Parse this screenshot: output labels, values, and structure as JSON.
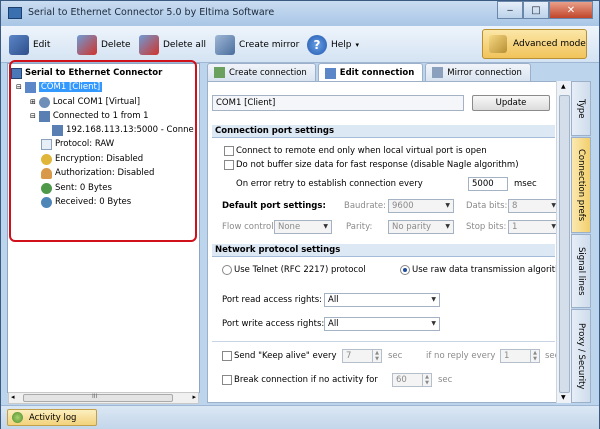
{
  "title": "Serial to Ethernet Connector 5.0 by Eltima Software",
  "toolbar": {
    "edit": "Edit",
    "delete": "Delete",
    "delete_all": "Delete all",
    "create_mirror": "Create mirror",
    "help": "Help",
    "advanced_mode": "Advanced mode"
  },
  "tree": {
    "root": "Serial to Ethernet Connector",
    "com1": "COM1 [Client]",
    "local": "Local COM1 [Virtual]",
    "connected": "Connected to 1 from 1",
    "remote": "192.168.113.13:5000 - Conne",
    "protocol": "Protocol: RAW",
    "encryption": "Encryption: Disabled",
    "authorization": "Authorization: Disabled",
    "sent": "Sent: 0 Bytes",
    "received": "Received: 0 Bytes"
  },
  "scroll_glyph": "III",
  "status": {
    "activity_log": "Activity log"
  },
  "tabs": [
    "Create connection",
    "Edit connection",
    "Mirror connection"
  ],
  "vtabs": [
    "Type",
    "Connection prefs",
    "Signal lines",
    "Proxy / Security"
  ],
  "panel": {
    "name_value": "COM1 [Client]",
    "update": "Update",
    "conn_section": "Connection port settings",
    "cb1": "Connect to remote end only when local virtual port is open",
    "cb2": "Do not buffer size data for fast response (disable Nagle algorithm)",
    "retry_label": "On error retry to establish connection every",
    "retry_value": "5000",
    "retry_unit": "msec",
    "default_port": "Default port settings:",
    "baudrate_label": "Baudrate:",
    "baudrate_value": "9600",
    "databits_label": "Data bits:",
    "databits_value": "8",
    "flow_label": "Flow control:",
    "flow_value": "None",
    "parity_label": "Parity:",
    "parity_value": "No parity",
    "stopbits_label": "Stop bits:",
    "stopbits_value": "1",
    "net_section": "Network protocol settings",
    "telnet": "Use Telnet (RFC 2217) protocol",
    "raw": "Use raw data transmission algorithms",
    "read_label": "Port read access rights:",
    "read_value": "All",
    "write_label": "Port write access rights:",
    "write_value": "All",
    "keepalive_label": "Send \"Keep alive\" every",
    "keepalive_value": "7",
    "sec1": "sec",
    "noreply_label": "if no reply every",
    "noreply_value": "1",
    "sec2": "sec",
    "break_label": "Break connection if no activity for",
    "break_value": "60",
    "sec3": "sec"
  },
  "colors": {
    "accent_red": "#d0101a",
    "selection": "#3399ff"
  }
}
